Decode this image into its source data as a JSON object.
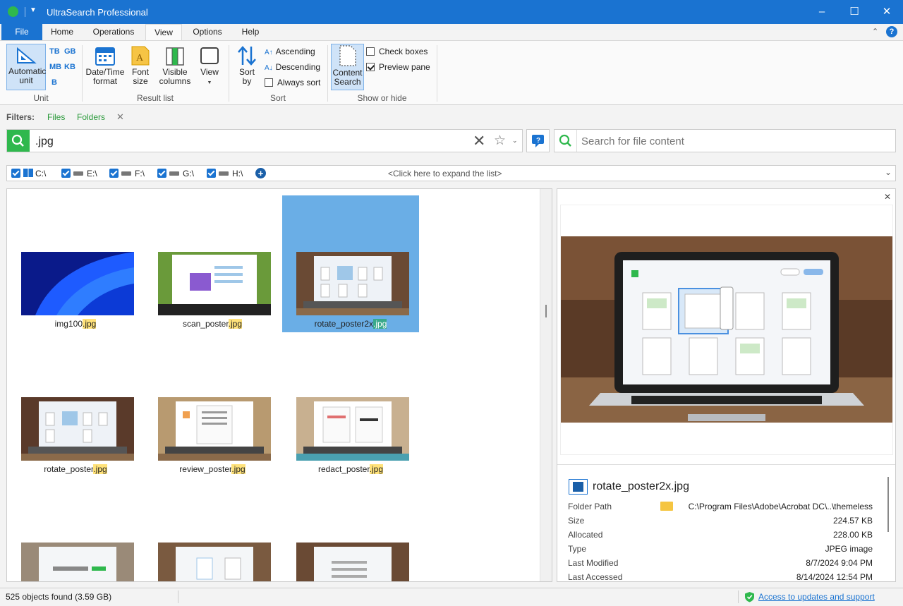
{
  "app": {
    "title": "UltraSearch Professional"
  },
  "menu": {
    "file": "File",
    "tabs": [
      "Home",
      "Operations",
      "View",
      "Options",
      "Help"
    ]
  },
  "ribbon": {
    "unit": {
      "automatic_unit": "Automatic unit",
      "tb": "TB",
      "gb": "GB",
      "mb": "MB",
      "kb": "KB",
      "b": "B",
      "group_label": "Unit"
    },
    "result_list": {
      "datetime": "Date/Time format",
      "font_size": "Font size",
      "visible_columns": "Visible columns",
      "view": "View",
      "group_label": "Result list"
    },
    "sort": {
      "sort_by": "Sort by",
      "ascending": "Ascending",
      "descending": "Descending",
      "always_sort": "Always sort",
      "group_label": "Sort"
    },
    "show_hide": {
      "content_search": "Content Search",
      "check_boxes": "Check boxes",
      "preview_pane": "Preview pane",
      "group_label": "Show or hide"
    }
  },
  "filters": {
    "label": "Filters:",
    "files": "Files",
    "folders": "Folders"
  },
  "search": {
    "query": ".jpg",
    "content_placeholder": "Search for file content"
  },
  "drives": {
    "items": [
      "C:\\",
      "E:\\",
      "F:\\",
      "G:\\",
      "H:\\"
    ],
    "expand_hint": "<Click here to expand the list>"
  },
  "results": [
    {
      "name": "img100",
      "ext": ".jpg"
    },
    {
      "name": "scan_poster",
      "ext": ".jpg"
    },
    {
      "name": "rotate_poster2x",
      "ext": ".jpg",
      "selected": true
    },
    {
      "name": "rotate_poster",
      "ext": ".jpg"
    },
    {
      "name": "review_poster",
      "ext": ".jpg"
    },
    {
      "name": "redact_poster",
      "ext": ".jpg"
    },
    {
      "name": "",
      "ext": ""
    },
    {
      "name": "",
      "ext": ""
    },
    {
      "name": "",
      "ext": ""
    }
  ],
  "preview": {
    "file_name": "rotate_poster2x.jpg",
    "props": [
      {
        "label": "Folder Path",
        "value": "C:\\Program Files\\Adobe\\Acrobat DC\\..\\themeless"
      },
      {
        "label": "Size",
        "value": "224.57 KB"
      },
      {
        "label": "Allocated",
        "value": "228.00 KB"
      },
      {
        "label": "Type",
        "value": "JPEG image"
      },
      {
        "label": "Last Modified",
        "value": "8/7/2024 9:04 PM"
      },
      {
        "label": "Last Accessed",
        "value": "8/14/2024 12:54 PM"
      }
    ]
  },
  "status": {
    "count": "525 objects found (3.59 GB)",
    "updates_link": "Access to updates and support"
  },
  "colors": {
    "accent": "#1a73d1",
    "green": "#2fb84d",
    "selection": "#6aaee6",
    "highlight": "#ffe27a"
  }
}
